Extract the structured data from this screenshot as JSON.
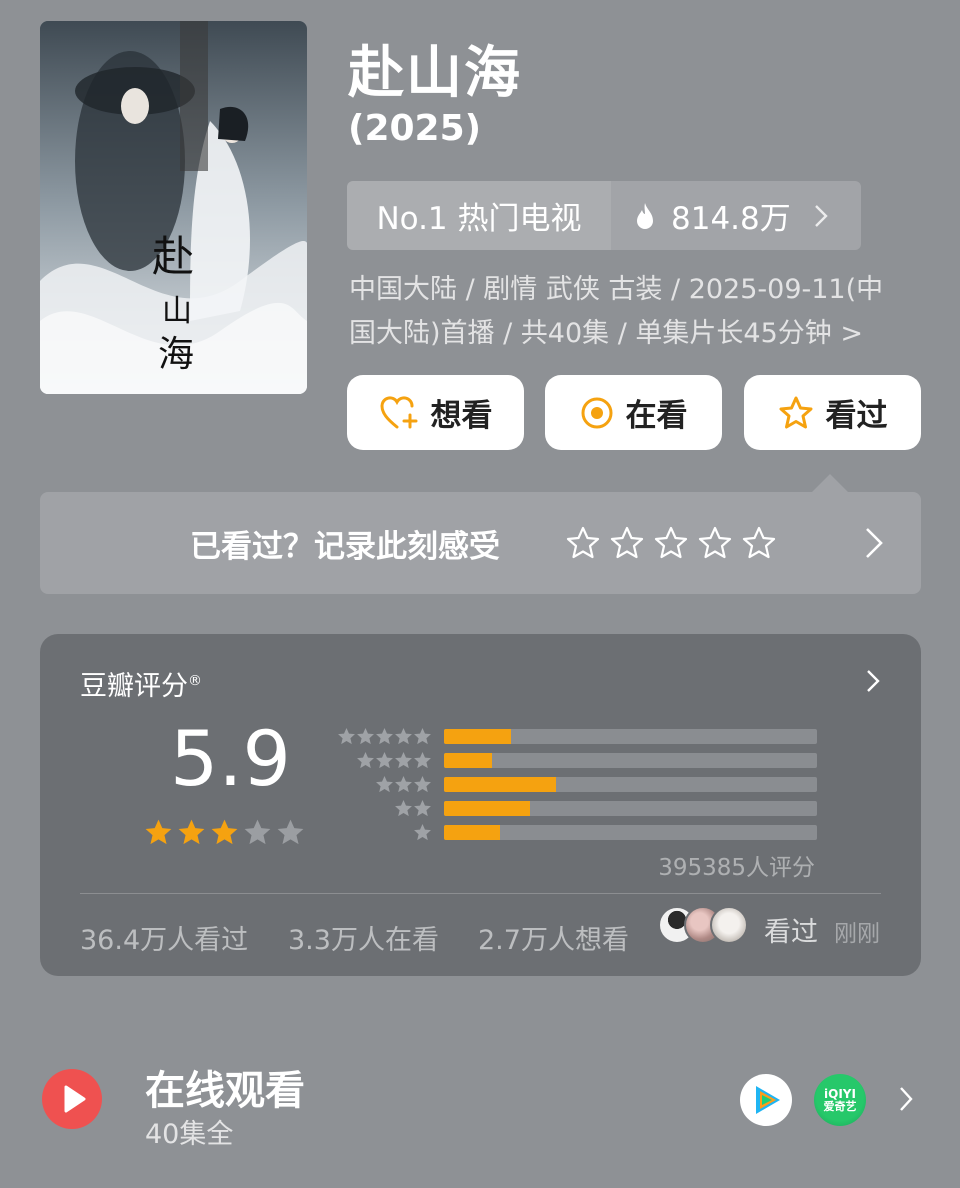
{
  "show": {
    "title": "赴山海",
    "year": "(2025)",
    "rank_label": "No.1 热门电视",
    "heat": "814.8万",
    "meta_line1": "中国大陆 / 剧情 武侠 古装 / 2025-09-11(中",
    "meta_line2": "国大陆)首播 / 共40集 / 单集片长45分钟 >"
  },
  "poster": {
    "title_glyphs": "赴山海"
  },
  "actions": {
    "want_label": "想看",
    "watching_label": "在看",
    "watched_label": "看过"
  },
  "record": {
    "prompt": "已看过？记录此刻感受"
  },
  "rating": {
    "title": "豆瓣评分",
    "registered": "®",
    "score": "5.9",
    "score_stars": 3,
    "distribution": [
      {
        "stars": 5,
        "fraction": 0.18
      },
      {
        "stars": 4,
        "fraction": 0.13
      },
      {
        "stars": 3,
        "fraction": 0.3
      },
      {
        "stars": 2,
        "fraction": 0.23
      },
      {
        "stars": 1,
        "fraction": 0.15
      }
    ],
    "count_text": "395385人评分",
    "watched_count": "36.4万人看过",
    "watching_count": "3.3万人在看",
    "want_count": "2.7万人想看",
    "friend_action": "看过",
    "friend_time": "刚刚"
  },
  "online": {
    "title": "在线观看",
    "episodes": "40集全",
    "iqiyi_text": "iQIYI",
    "iqiyi_sub": "爱奇艺"
  },
  "colors": {
    "accent_orange": "#f5a210",
    "play_red": "#ef5150",
    "background": "#8e9195",
    "card": "#6c6f73"
  }
}
